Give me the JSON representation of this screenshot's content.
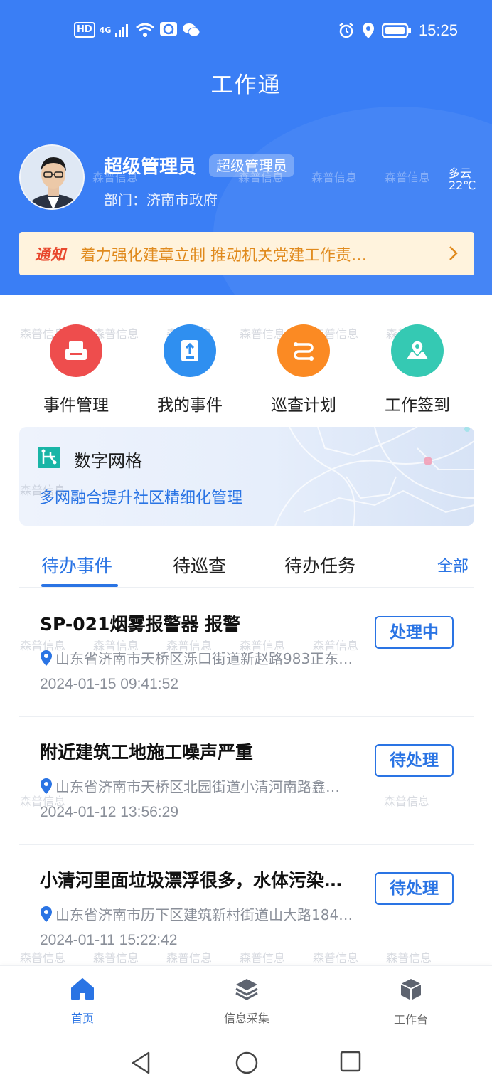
{
  "status_bar": {
    "time": "15:25",
    "hd": "HD",
    "network": "4G",
    "icons": [
      "hd-icon",
      "signal-icon",
      "wifi-icon",
      "chat-app-icon",
      "wechat-icon",
      "alarm-icon",
      "location-icon",
      "battery-icon"
    ]
  },
  "app": {
    "title": "工作通"
  },
  "user": {
    "name": "超级管理员",
    "role_badge": "超级管理员",
    "department": "部门：济南市政府"
  },
  "weather": {
    "condition": "多云",
    "temperature": "22℃"
  },
  "notice": {
    "tag": "通知",
    "text": "着力强化建章立制 推动机关党建工作责…"
  },
  "shortcuts": [
    {
      "label": "事件管理",
      "icon": "event-manage-icon",
      "color": "#ee4d4d"
    },
    {
      "label": "我的事件",
      "icon": "my-event-icon",
      "color": "#2f8ff0"
    },
    {
      "label": "巡查计划",
      "icon": "patrol-plan-icon",
      "color": "#fb8a23"
    },
    {
      "label": "工作签到",
      "icon": "checkin-map-icon",
      "color": "#35c9b3"
    }
  ],
  "grid_card": {
    "title": "数字网格",
    "subtitle": "多网融合提升社区精细化管理"
  },
  "tabs": {
    "items": [
      "待办事件",
      "待巡查",
      "待办任务"
    ],
    "active": "待办事件",
    "all": "全部"
  },
  "events": [
    {
      "title": "SP-021烟雾报警器 报警",
      "address": "山东省济南市天桥区泺口街道新赵路983正东…",
      "time": "2024-01-15 09:41:52",
      "status": "处理中"
    },
    {
      "title": "附近建筑工地施工噪声严重",
      "address": "山东省济南市天桥区北园街道小清河南路鑫…",
      "time": "2024-01-12 13:56:29",
      "status": "待处理"
    },
    {
      "title": "小清河里面垃圾漂浮很多，水体污染…",
      "address": "山东省济南市历下区建筑新村街道山大路184…",
      "time": "2024-01-11 15:22:42",
      "status": "待处理"
    }
  ],
  "bottom_nav": [
    {
      "label": "首页",
      "icon": "home-icon",
      "active": true
    },
    {
      "label": "信息采集",
      "icon": "layers-icon",
      "active": false
    },
    {
      "label": "工作台",
      "icon": "cube-icon",
      "active": false
    }
  ],
  "watermark": "森普信息",
  "colors": {
    "primary": "#3a7ef5",
    "accent": "#2a74e4",
    "notice_bg": "#fff3dd",
    "notice_text": "#e08a1d",
    "notice_tag": "#e8472c"
  }
}
